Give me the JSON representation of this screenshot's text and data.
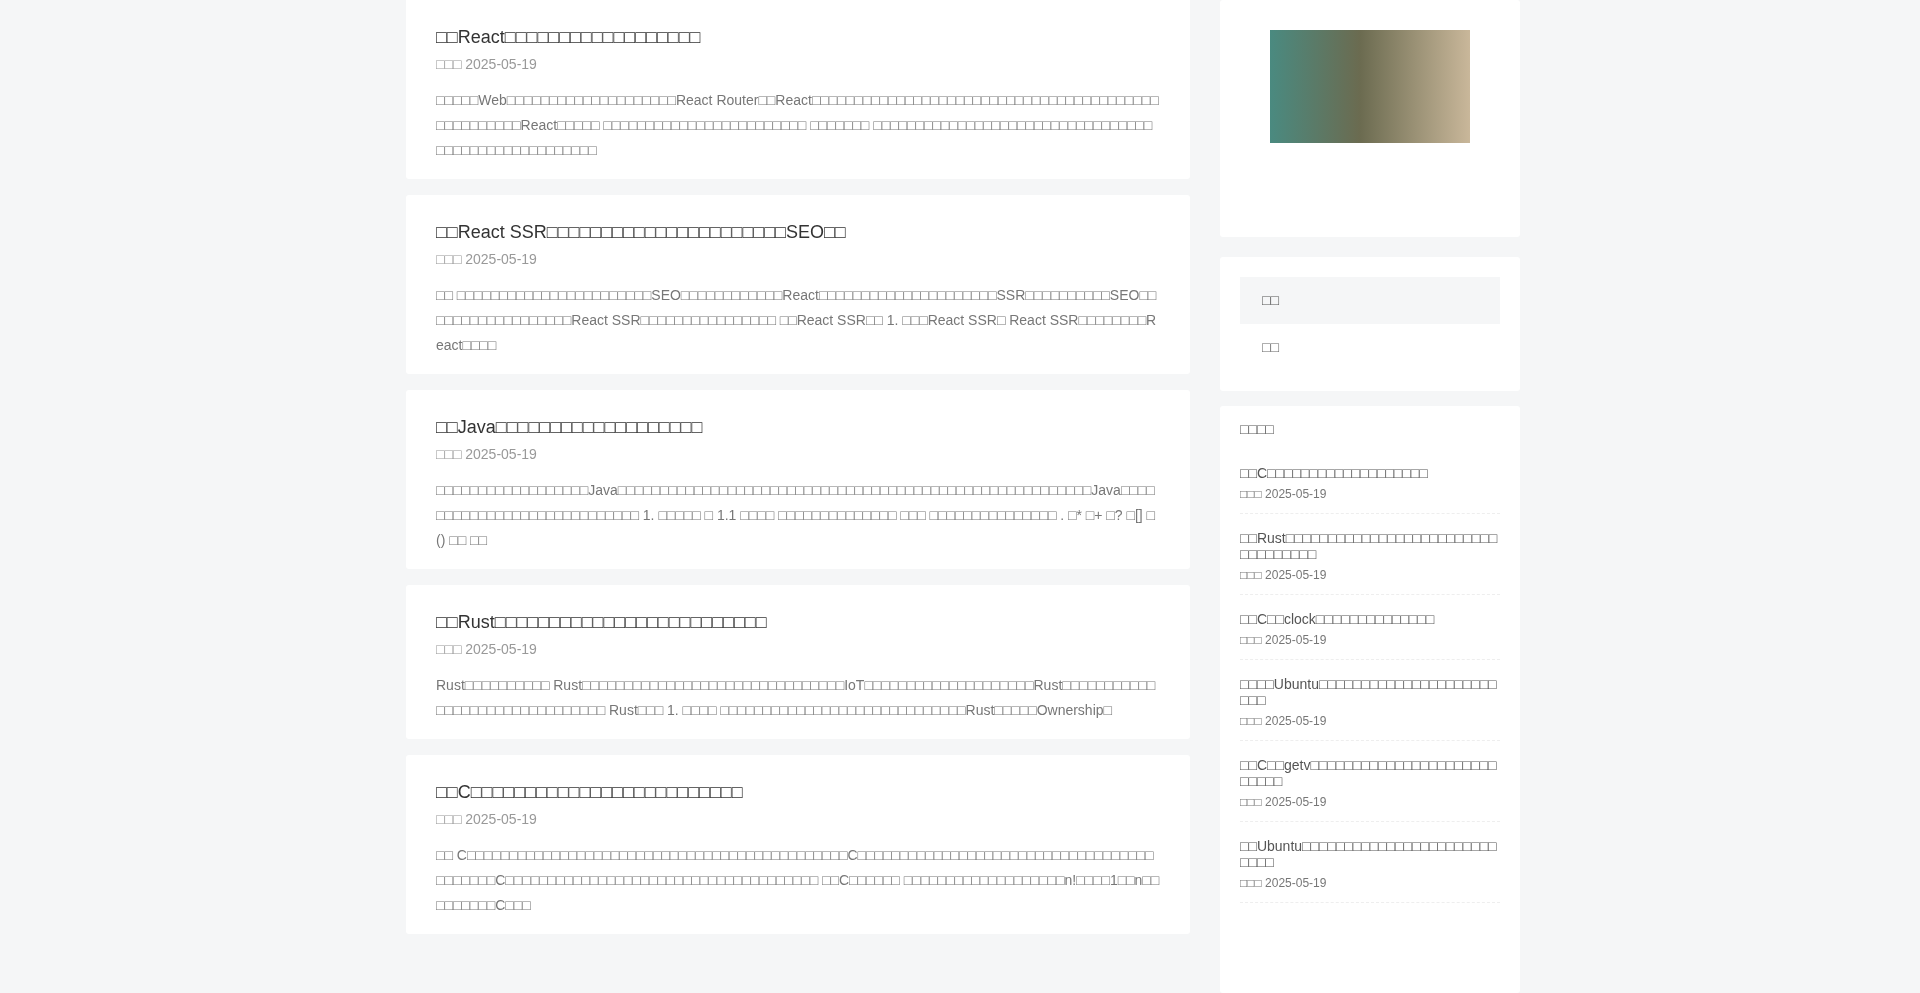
{
  "posts": [
    {
      "title": "□□React□□□□□□□□□□□□□□□□□□",
      "date": "□□□ 2025-05-19",
      "excerpt": "□□□□□Web□□□□□□□□□□□□□□□□□□□□React Router□□React□□□□□□□□□□□□□□□□□□□□□□□□□□□□□□□□□□□□□□□□□□□□□□□□□□□React□□□□□ □□□□□□□□□□□□□□□□□□□□□□□□ □□□□□□□ □□□□□□□□□□□□□□□□□□□□□□□□□□□□□□□□□□□□□□□□□□□□□□□□□□□□"
    },
    {
      "title": "□□React SSR□□□□□□□□□□□□□□□□□□□□□□SEO□□",
      "date": "□□□ 2025-05-19",
      "excerpt": "□□ □□□□□□□□□□□□□□□□□□□□□□□SEO□□□□□□□□□□□□React□□□□□□□□□□□□□□□□□□□□□SSR□□□□□□□□□□SEO□□□□□□□□□□□□□□□□□□React SSR□□□□□□□□□□□□□□□□ □□React SSR□□ 1. □□□React SSR□ React SSR□□□□□□□□React□□□□"
    },
    {
      "title": "□□Java□□□□□□□□□□□□□□□□□□□",
      "date": "□□□ 2025-05-19",
      "excerpt": "□□□□□□□□□□□□□□□□□□Java□□□□□□□□□□□□□□□□□□□□□□□□□□□□□□□□□□□□□□□□□□□□□□□□□□□□□□□□Java□□□□□□□□□□□□□□□□□□□□□□□□□□□□ 1. □□□□□ □ 1.1 □□□□ □□□□□□□□□□□□□□ □□□ □□□□□□□□□□□□□□□ . □* □+ □? □[] □() □□ □□"
    },
    {
      "title": "□□Rust□□□□□□□□□□□□□□□□□□□□□□□□□",
      "date": "□□□ 2025-05-19",
      "excerpt": "Rust□□□□□□□□□□ Rust□□□□□□□□□□□□□□□□□□□□□□□□□□□□□□□IoT□□□□□□□□□□□□□□□□□□□□Rust□□□□□□□□□□□□□□□□□□□□□□□□□□□□□□□ Rust□□□ 1. □□□□ □□□□□□□□□□□□□□□□□□□□□□□□□□□□□Rust□□□□□Ownership□"
    },
    {
      "title": "□□C□□□□□□□□□□□□□□□□□□□□□□□□□",
      "date": "□□□ 2025-05-19",
      "excerpt": "□□ C□□□□□□□□□□□□□□□□□□□□□□□□□□□□□□□□□□□□□□□□□□□□□C□□□□□□□□□□□□□□□□□□□□□□□□□□□□□□□□□□□□□□□□□□C□□□□□□□□□□□□□□□□□□□□□□□□□□□□□□□□□□□□□ □□C□□□□□□ □□□□□□□□□□□□□□□□□□□n!□□□□1□□n□□□□□□□□□C□□□"
    }
  ],
  "sidebar": {
    "menu": [
      {
        "label": "□□",
        "selected": true
      },
      {
        "label": "□□",
        "selected": false
      }
    ],
    "recent": {
      "heading": "□□□□",
      "items": [
        {
          "title": "□□C□□□□□□□□□□□□□□□□□□□",
          "date": "□□□ 2025-05-19"
        },
        {
          "title": "□□Rust□□□□□□□□□□□□□□□□□□□□□□□□□□□□□□□□□□",
          "date": "□□□ 2025-05-19"
        },
        {
          "title": "□□C□□clock□□□□□□□□□□□□□□",
          "date": "□□□ 2025-05-19"
        },
        {
          "title": "□□□□Ubuntu□□□□□□□□□□□□□□□□□□□□□□□□",
          "date": "□□□ 2025-05-19"
        },
        {
          "title": "□□C□□getv□□□□□□□□□□□□□□□□□□□□□□□□□□□",
          "date": "□□□ 2025-05-19"
        },
        {
          "title": "□□Ubuntu□□□□□□□□□□□□□□□□□□□□□□□□□□□",
          "date": "□□□ 2025-05-19"
        }
      ]
    }
  }
}
